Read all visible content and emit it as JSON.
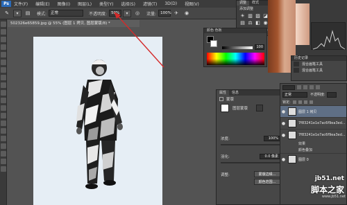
{
  "menubar": {
    "logo": "Ps",
    "items": [
      "文件(F)",
      "编辑(E)",
      "图像(I)",
      "图层(L)",
      "类型(Y)",
      "选择(S)",
      "滤镜(T)",
      "3D(D)",
      "视图(V)"
    ]
  },
  "options": {
    "mode_label": "模式:",
    "mode_value": "正常",
    "opacity_label": "不透明度:",
    "opacity_value": "50%",
    "flow_label": "流量:",
    "flow_value": "100%"
  },
  "document": {
    "tab_title": "502326e65859.jpg @ 55% (图层 1 拷贝, 图层蒙版/8) *"
  },
  "adjustments": {
    "tab_active": "调整",
    "tab_other": "样式",
    "title": "添加调整"
  },
  "color_panel": {
    "tab_label": "颜色  色板",
    "value": "100"
  },
  "history": {
    "tab_label": "历史记录",
    "items": [
      "混合画笔工具",
      "混合画笔工具"
    ]
  },
  "properties": {
    "tab_active": "属性",
    "tab_other": "信息",
    "header": "蒙版",
    "mask_label": "图层蒙版",
    "density_label": "浓度:",
    "density_value": "100%",
    "feather_label": "羽化:",
    "feather_value": "0.0 像素",
    "refine_label": "调整:",
    "edge_button": "蒙版边缘...",
    "color_range_button": "颜色范围..."
  },
  "layers": {
    "blend_mode": "正常",
    "opacity_label": "不透明度:",
    "lock_label": "锁定:",
    "items": [
      {
        "name": "图层 1 拷贝"
      },
      {
        "name": "7f83241e1e7ac6f9ea3ed..."
      },
      {
        "name": "7f83241e1e7ac6f9ea3ed..."
      },
      {
        "name": "效果"
      },
      {
        "name": "颜色叠加"
      },
      {
        "name": "图层 0"
      }
    ]
  },
  "watermark": {
    "line1": "jb51.net",
    "line2": "脚本之家",
    "line3": "www.jb51.net"
  }
}
